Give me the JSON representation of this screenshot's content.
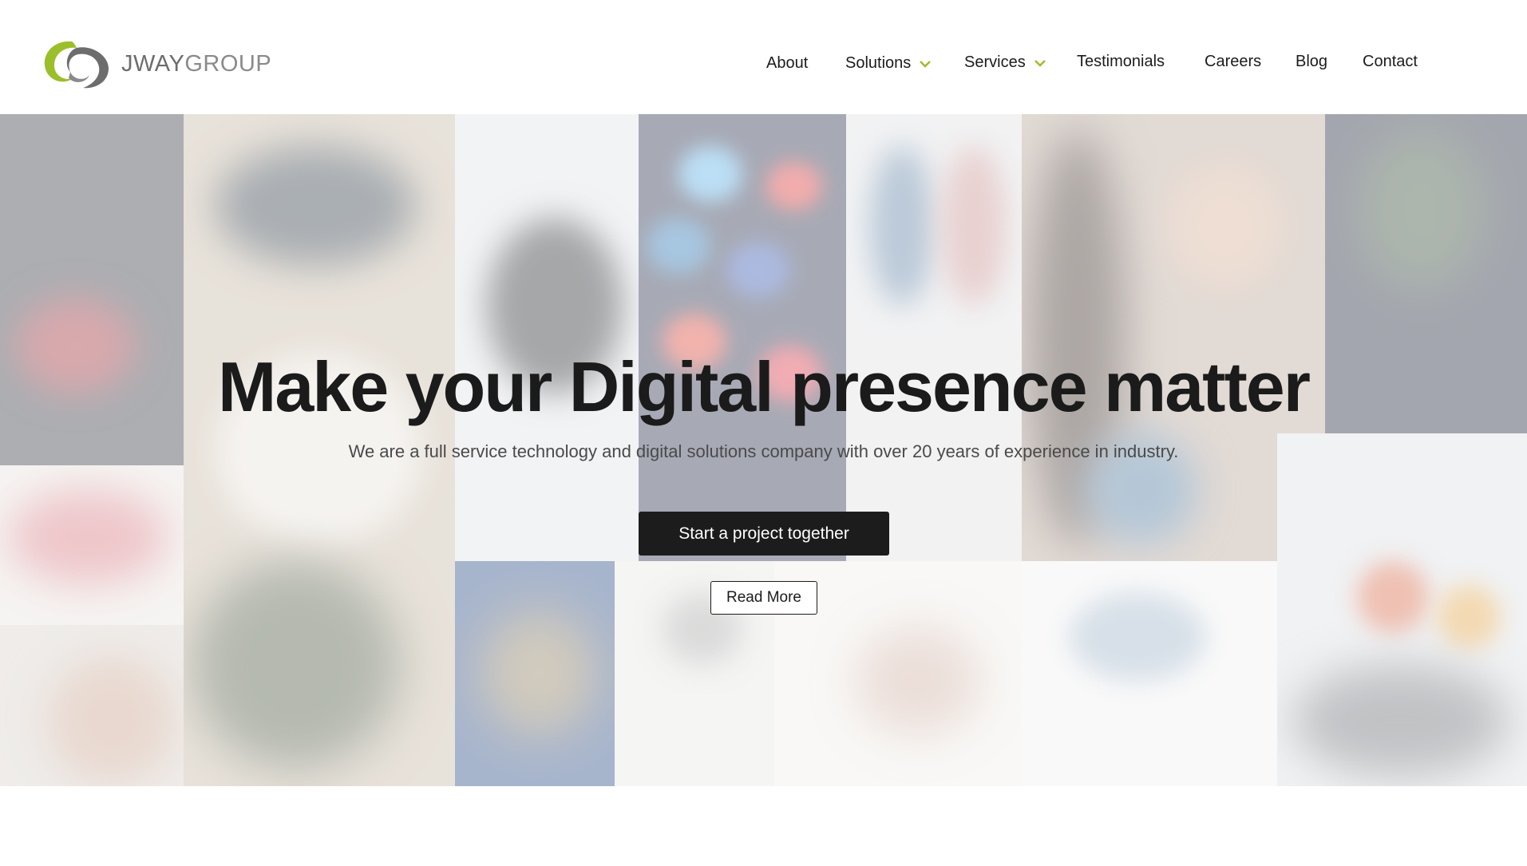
{
  "brand": {
    "name_bold": "JWAY",
    "name_light": "GROUP",
    "logo_icon": "jway-swirl-logo",
    "accent_color": "#9bbf2b",
    "logo_grey": "#6d6d6d"
  },
  "nav": {
    "about": "About",
    "solutions": "Solutions",
    "services": "Services",
    "testimonials": "Testimonials",
    "careers": "Careers",
    "blog": "Blog",
    "contact": "Contact",
    "dropdown_icon": "chevron-down-icon"
  },
  "hero": {
    "title": "Make your Digital presence matter",
    "subtitle": "We are a full service technology and digital solutions company with over 20 years of experience in industry.",
    "primary_cta": "Start a project together",
    "secondary_cta": "Read More",
    "background": "blurred-photo-collage"
  }
}
